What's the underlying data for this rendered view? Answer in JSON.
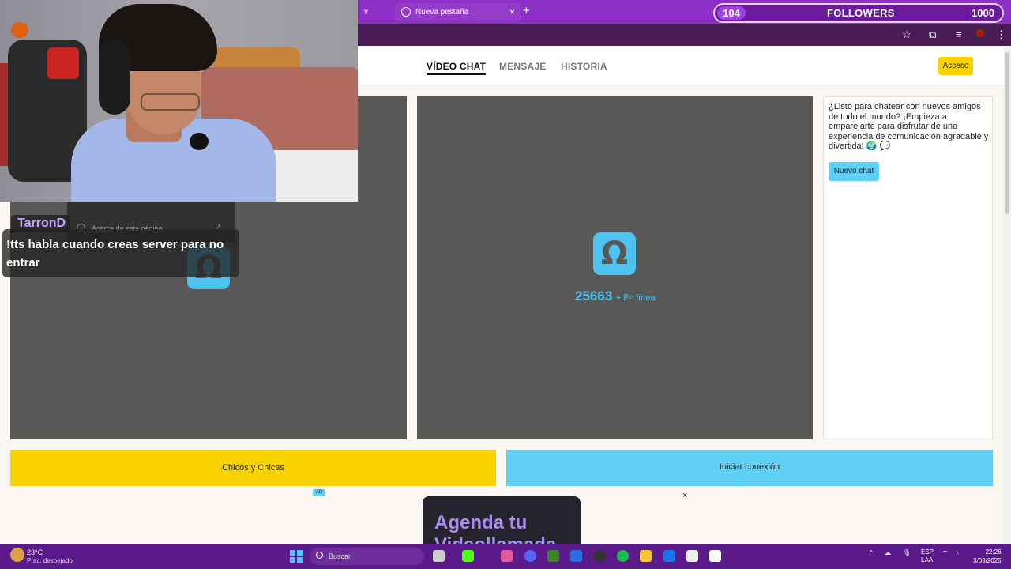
{
  "browser": {
    "tabs": [
      {
        "label": "",
        "close": "×"
      },
      {
        "label": "Nueva pestaña",
        "close": "×"
      }
    ],
    "new_tab": "+"
  },
  "followers_widget": {
    "count": "104",
    "label": "FOLLOWERS",
    "goal": "1000"
  },
  "site": {
    "nav": [
      {
        "label": "VÍDEO CHAT",
        "active": true
      },
      {
        "label": "MENSAJE",
        "active": false
      },
      {
        "label": "HISTORIA",
        "active": false
      }
    ],
    "login_label": "Acceso",
    "online_count": "25663",
    "online_suffix": "+ En línea",
    "side_text": "¿Listo para chatear con nuevos amigos de todo el mundo? ¡Empieza a emparejarte para disfrutar de una experiencia de comunicación agradable y divertida! 🌍 💬",
    "new_chat_label": "Nuevo chat",
    "gender_button_label": "Chicos y Chicas",
    "connect_button_label": "Iniciar conexión",
    "ad_badge": "AD",
    "ad_close": "×",
    "ad_line1": "Agenda tu",
    "ad_line2": "Videollamada"
  },
  "stream_chat": {
    "username": "TarronD",
    "message": "!tts habla cuando creas server para no entrar",
    "menu_item": "Acerca de esta página"
  },
  "taskbar": {
    "temperature": "23°C",
    "weather": "Prac. despejado",
    "search_placeholder": "Buscar",
    "lang1": "ESP",
    "lang2": "LAA",
    "time": "22:26",
    "date": "3/03/2026"
  },
  "colors": {
    "accent_yellow": "#f8d300",
    "accent_blue": "#5fcff4",
    "tab_purple": "#8e2fc7",
    "panel_gray": "#595a58"
  }
}
